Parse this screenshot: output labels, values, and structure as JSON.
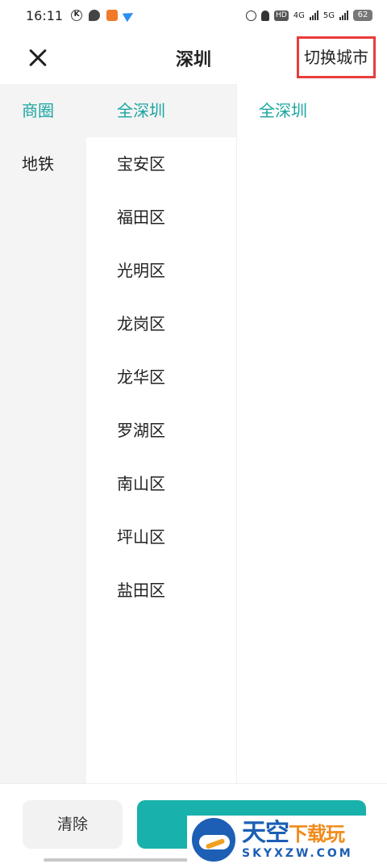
{
  "status_bar": {
    "time": "16:11",
    "left_icons": [
      "k-icon",
      "chat-icon",
      "app-icon",
      "plane-icon"
    ],
    "hd_label": "HD",
    "net_4g": "4G",
    "net_5g": "5G",
    "battery": "62"
  },
  "header": {
    "title": "深圳",
    "switch_city": "切换城市",
    "highlight_color": "#e93c3c"
  },
  "left_menu": {
    "items": [
      {
        "label": "商圈",
        "active": true
      },
      {
        "label": "地铁",
        "active": false
      }
    ]
  },
  "mid_menu": {
    "items": [
      {
        "label": "全深圳",
        "active": true
      },
      {
        "label": "宝安区",
        "active": false
      },
      {
        "label": "福田区",
        "active": false
      },
      {
        "label": "光明区",
        "active": false
      },
      {
        "label": "龙岗区",
        "active": false
      },
      {
        "label": "龙华区",
        "active": false
      },
      {
        "label": "罗湖区",
        "active": false
      },
      {
        "label": "南山区",
        "active": false
      },
      {
        "label": "坪山区",
        "active": false
      },
      {
        "label": "盐田区",
        "active": false
      }
    ]
  },
  "right_menu": {
    "items": [
      {
        "label": "全深圳"
      }
    ]
  },
  "bottom": {
    "clear_label": "清除",
    "accent_color": "#19b1ab"
  },
  "watermark": {
    "cn_main": "天空",
    "cn_sub": "下载玩",
    "en": "SKYXZW.COM"
  }
}
